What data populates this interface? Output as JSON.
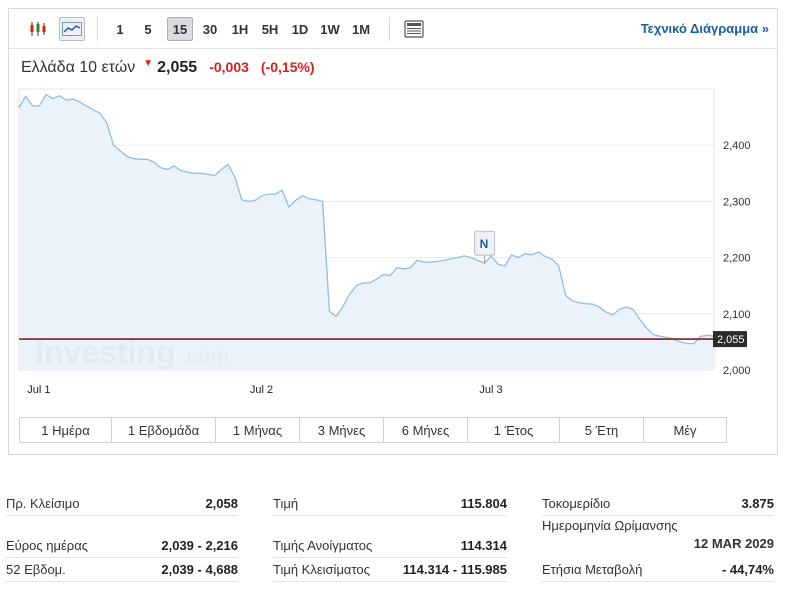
{
  "toolbar": {
    "candles_icon": "candlestick-chart-icon",
    "line_icon": "line-chart-icon",
    "intervals": [
      {
        "label": "1",
        "active": false
      },
      {
        "label": "5",
        "active": false
      },
      {
        "label": "15",
        "active": true
      },
      {
        "label": "30",
        "active": false
      },
      {
        "label": "1H",
        "active": false
      },
      {
        "label": "5H",
        "active": false
      },
      {
        "label": "1D",
        "active": false
      },
      {
        "label": "1W",
        "active": false
      },
      {
        "label": "1M",
        "active": false
      }
    ],
    "table_icon": "data-table-icon",
    "technical_link": "Τεχνικό Διάγραμμα »"
  },
  "quote": {
    "name": "Ελλάδα 10 ετών",
    "price": "2,055",
    "change": "-0,003",
    "change_pct": "(-0,15%)",
    "direction_icon": "down-arrow-icon"
  },
  "chart_data": {
    "type": "area",
    "x_labels": [
      "Jul 1",
      "Jul 2",
      "Jul 3"
    ],
    "y_ticks": [
      "2,400",
      "2,300",
      "2,200",
      "2,100",
      "2,000"
    ],
    "ylim": [
      2.0,
      2.5
    ],
    "current_value": 2.055,
    "current_label": "2,055",
    "event_marker": "N",
    "watermark": "Investing",
    "watermark_suffix": ".com",
    "series": [
      {
        "name": "",
        "values": [
          2.467,
          2.487,
          2.47,
          2.47,
          2.49,
          2.483,
          2.488,
          2.48,
          2.482,
          2.477,
          2.47,
          2.463,
          2.457,
          2.44,
          2.4,
          2.39,
          2.38,
          2.376,
          2.375,
          2.375,
          2.37,
          2.36,
          2.357,
          2.363,
          2.355,
          2.352,
          2.35,
          2.35,
          2.348,
          2.346,
          2.357,
          2.366,
          2.343,
          2.303,
          2.3,
          2.302,
          2.31,
          2.313,
          2.313,
          2.32,
          2.29,
          2.302,
          2.31,
          2.305,
          2.303,
          2.3,
          2.105,
          2.095,
          2.113,
          2.135,
          2.15,
          2.155,
          2.155,
          2.162,
          2.17,
          2.168,
          2.182,
          2.18,
          2.182,
          2.195,
          2.192,
          2.192,
          2.193,
          2.195,
          2.198,
          2.2,
          2.203,
          2.2,
          2.195,
          2.19,
          2.203,
          2.188,
          2.185,
          2.205,
          2.2,
          2.207,
          2.205,
          2.21,
          2.202,
          2.197,
          2.185,
          2.133,
          2.123,
          2.12,
          2.118,
          2.117,
          2.112,
          2.103,
          2.098,
          2.108,
          2.112,
          2.108,
          2.09,
          2.075,
          2.063,
          2.06,
          2.058,
          2.055,
          2.05,
          2.047,
          2.047,
          2.06,
          2.062,
          2.06
        ]
      }
    ]
  },
  "periods": [
    "1 Ημέρα",
    "1 Εβδομάδα",
    "1 Μήνας",
    "3 Μήνες",
    "6 Μήνες",
    "1 Έτος",
    "5 Έτη",
    "Μέγ"
  ],
  "stats": {
    "col1": [
      {
        "label": "Πρ. Κλείσιμο",
        "value": "2,058"
      },
      {
        "label": "Εύρος ημέρας",
        "value": "2,039 - 2,216"
      },
      {
        "label": "52 Εβδομ.",
        "value": "2,039 - 4,688"
      }
    ],
    "col2": [
      {
        "label": "Τιμή",
        "value": "115.804"
      },
      {
        "label": "Τιμής Ανοίγματος",
        "value": "114.314"
      },
      {
        "label": "Τιμή Κλεισίματος",
        "value": "114.314 - 115.985"
      }
    ],
    "col3": [
      {
        "label": "Τοκομερίδιο",
        "value": "3.875"
      },
      {
        "label": "Ημερομηνία Ωρίμανσης",
        "value": "12 MAR 2029"
      },
      {
        "label": "Ετήσια Μεταβολή",
        "value": "- 44,74%"
      }
    ]
  },
  "colors": {
    "accent": "#1c5d9c",
    "negative": "#d91e1e",
    "line": "#8fbfe3",
    "area": "#e7f0f8",
    "current_line": "#8b1a1a"
  }
}
